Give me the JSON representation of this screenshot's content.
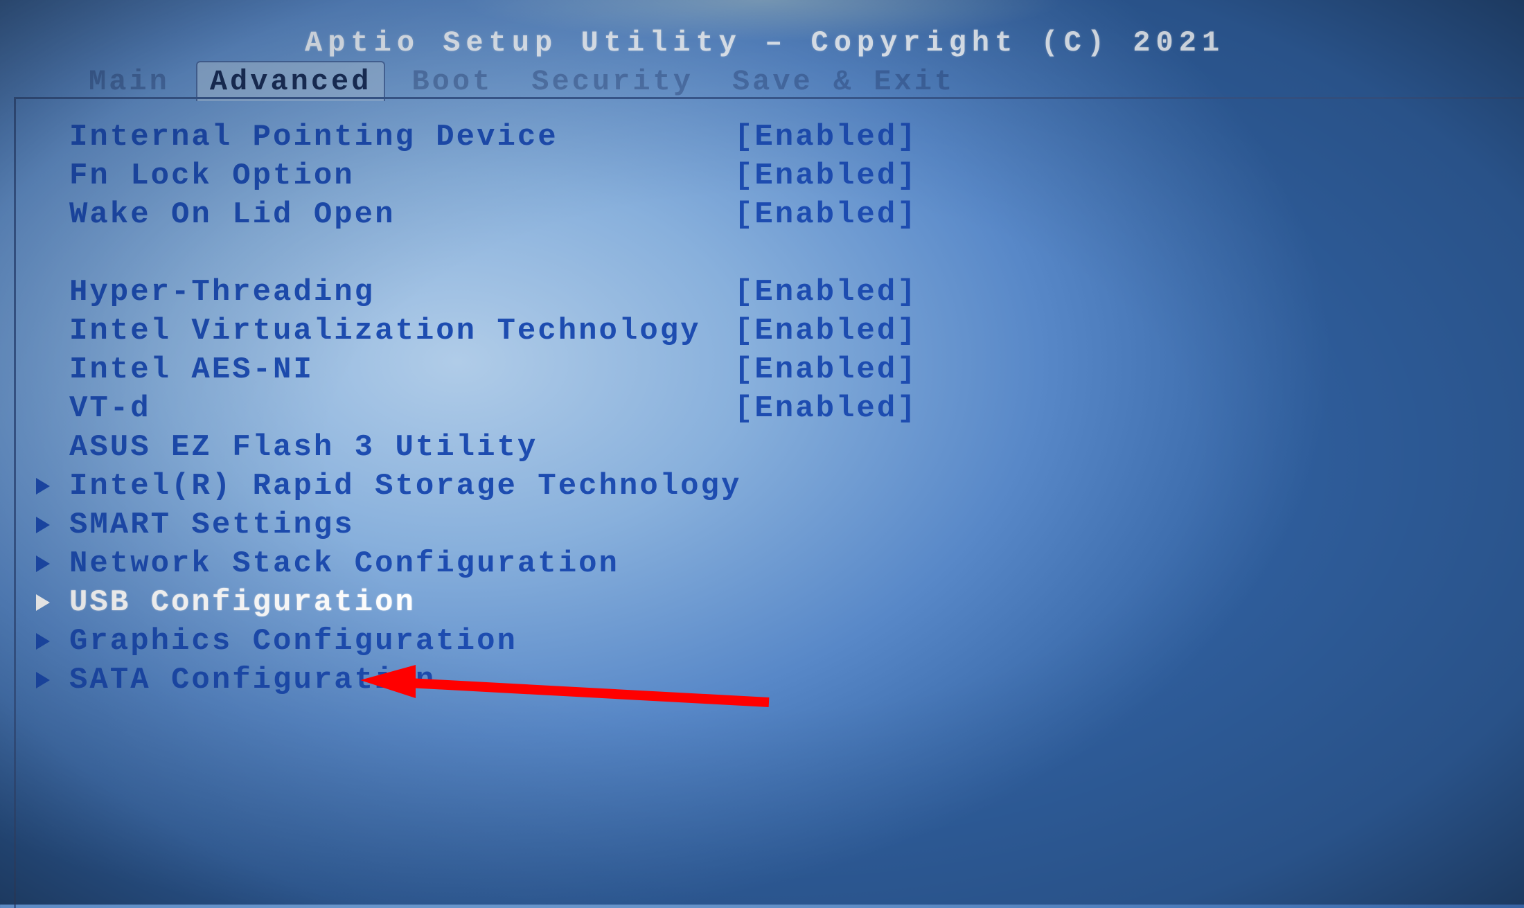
{
  "title": "Aptio Setup Utility – Copyright (C) 2021",
  "tabs": [
    {
      "label": "Main",
      "active": false
    },
    {
      "label": "Advanced",
      "active": true
    },
    {
      "label": "Boot",
      "active": false
    },
    {
      "label": "Security",
      "active": false
    },
    {
      "label": "Save & Exit",
      "active": false
    }
  ],
  "settings": [
    {
      "label": "Internal Pointing Device",
      "value": "[Enabled]",
      "submenu": false,
      "selected": false
    },
    {
      "label": "Fn Lock Option",
      "value": "[Enabled]",
      "submenu": false,
      "selected": false
    },
    {
      "label": "Wake On Lid Open",
      "value": "[Enabled]",
      "submenu": false,
      "selected": false
    },
    {
      "spacer": true
    },
    {
      "label": "Hyper-Threading",
      "value": "[Enabled]",
      "submenu": false,
      "selected": false
    },
    {
      "label": "Intel Virtualization Technology",
      "value": "[Enabled]",
      "submenu": false,
      "selected": false
    },
    {
      "label": "Intel AES-NI",
      "value": "[Enabled]",
      "submenu": false,
      "selected": false
    },
    {
      "label": "VT-d",
      "value": "[Enabled]",
      "submenu": false,
      "selected": false
    },
    {
      "label": "ASUS EZ Flash 3 Utility",
      "value": "",
      "submenu": false,
      "selected": false
    },
    {
      "label": "Intel(R) Rapid Storage Technology",
      "value": "",
      "submenu": true,
      "selected": false
    },
    {
      "label": "SMART Settings",
      "value": "",
      "submenu": true,
      "selected": false
    },
    {
      "label": "Network Stack Configuration",
      "value": "",
      "submenu": true,
      "selected": false
    },
    {
      "label": "USB Configuration",
      "value": "",
      "submenu": true,
      "selected": true
    },
    {
      "label": "Graphics Configuration",
      "value": "",
      "submenu": true,
      "selected": false
    },
    {
      "label": "SATA Configuration",
      "value": "",
      "submenu": true,
      "selected": false
    }
  ],
  "annotation": {
    "target": "USB Configuration",
    "color": "#ff0000"
  }
}
